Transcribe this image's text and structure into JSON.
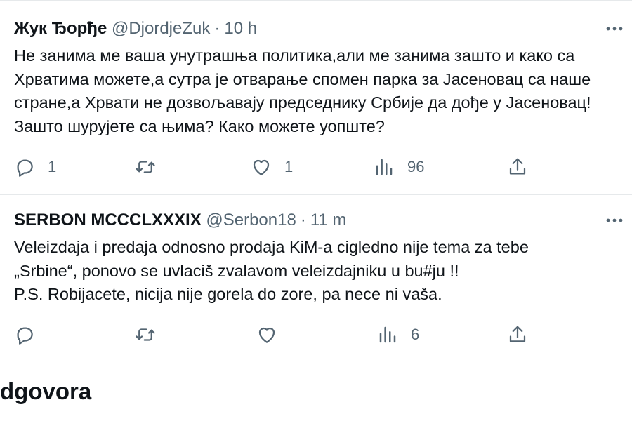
{
  "tweets": [
    {
      "author_name": "Жук Ђорђе",
      "handle": "@DjordjeZuk",
      "separator": "·",
      "time": "10 h",
      "text": "Не занима ме ваша унутрашња политика,али ме занима зашто и како са\nХрватима можете,а сутра је отварање спомен парка за Јасеновац са наше\nстране,а Хрвати не дозвољавају председнику Србије да дође у Јасеновац!\nЗашто шурујете са њима? Како можете уопште?",
      "replies": "1",
      "reposts": "",
      "likes": "1",
      "views": "96"
    },
    {
      "author_name": "SERBON MCCCLXXXIX",
      "handle": "@Serbon18",
      "separator": "·",
      "time": "11 m",
      "text": "Veleizdaja i predaja odnosno prodaja KiM-a cigledno nije tema za tebe\n„Srbine“, ponovo se uvlaciš zvalavom veleizdajniku u bu#ju !!\nP.S. Robijacete, nicija nije gorela do zore, pa nece ni vaša.",
      "replies": "",
      "reposts": "",
      "likes": "",
      "views": "6"
    }
  ],
  "section_title": "dgovora",
  "icons": {
    "more": "more-dots-icon",
    "reply": "reply-bubble-icon",
    "repost": "repost-arrows-icon",
    "like": "heart-icon",
    "views": "views-bars-icon",
    "share": "share-upload-icon"
  },
  "colors": {
    "text": "#0f1419",
    "secondary": "#536471",
    "divider": "#e6e9eb",
    "background": "#ffffff"
  }
}
